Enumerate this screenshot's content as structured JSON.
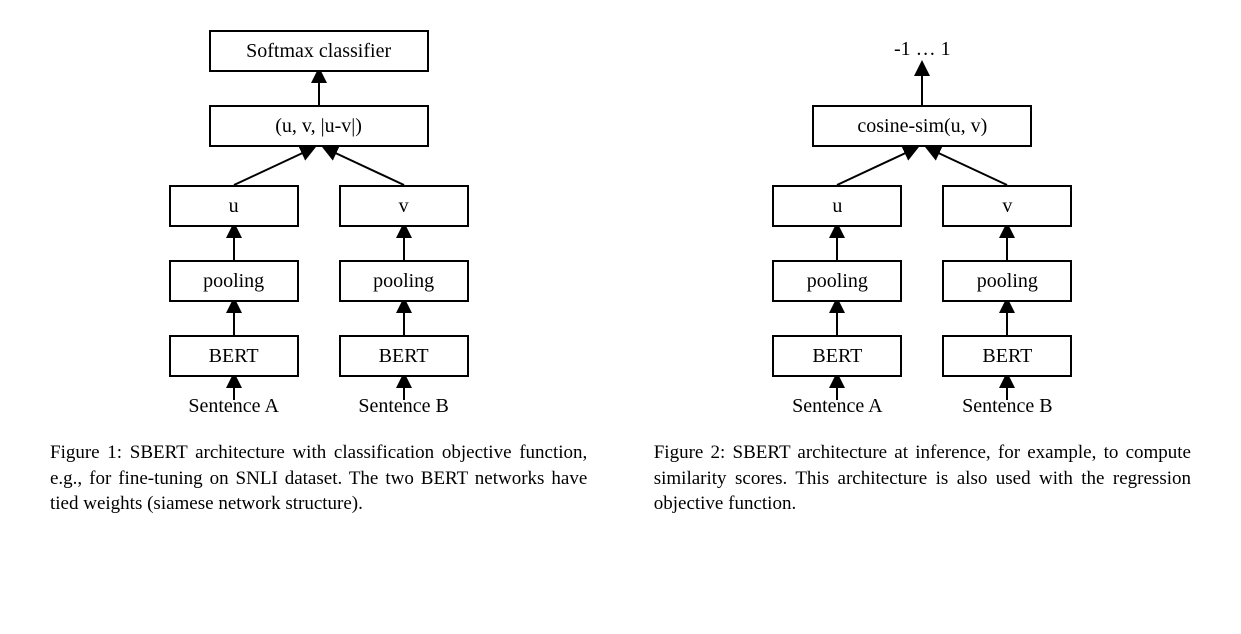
{
  "figure1": {
    "softmax": "Softmax classifier",
    "concat": "(u, v, |u-v|)",
    "u": "u",
    "v": "v",
    "pooling_a": "pooling",
    "pooling_b": "pooling",
    "bert_a": "BERT",
    "bert_b": "BERT",
    "sentence_a": "Sentence A",
    "sentence_b": "Sentence B",
    "caption": "Figure 1: SBERT architecture with classification objective function, e.g., for fine-tuning on SNLI dataset. The two BERT networks have tied weights (siamese network structure)."
  },
  "figure2": {
    "output": "-1 … 1",
    "cosine": "cosine-sim(u, v)",
    "u": "u",
    "v": "v",
    "pooling_a": "pooling",
    "pooling_b": "pooling",
    "bert_a": "BERT",
    "bert_b": "BERT",
    "sentence_a": "Sentence A",
    "sentence_b": "Sentence B",
    "caption": "Figure 2: SBERT architecture at inference, for example, to compute similarity scores. This architecture is also used with the regression objective function."
  }
}
